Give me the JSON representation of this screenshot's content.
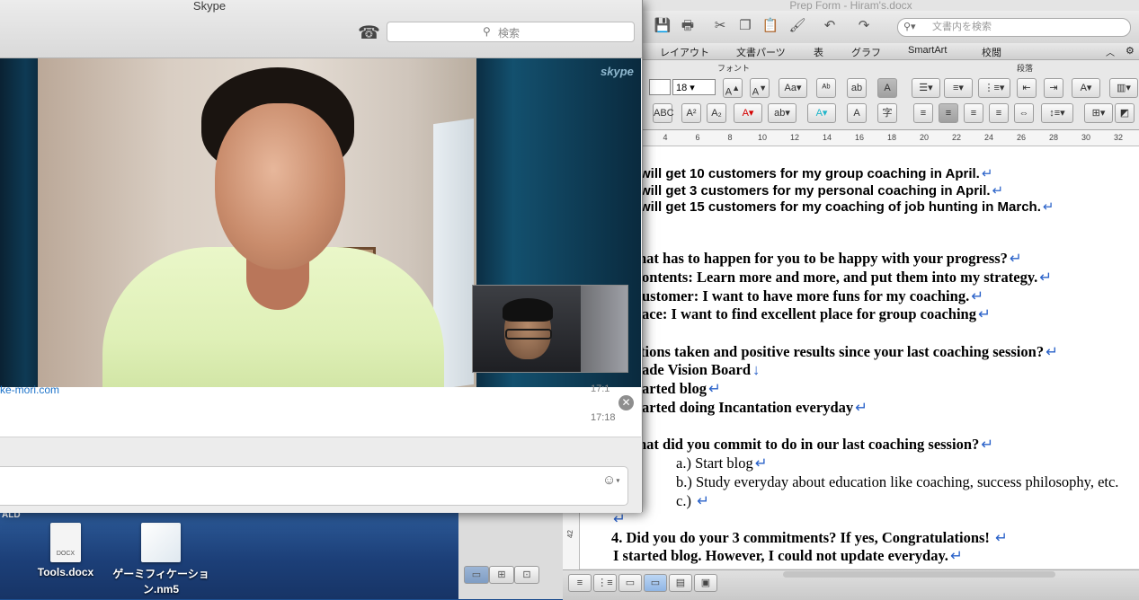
{
  "skype": {
    "title": "Skype",
    "search_placeholder": "検索",
    "watermark": "skype",
    "chat": {
      "link_text": "ke-mori.com",
      "time_top": "17:1",
      "time_bottom": "17:18"
    }
  },
  "word": {
    "title": "Prep Form - Hiram's.docx",
    "search_placeholder": "文書内を検索",
    "ribbon_tabs": [
      "レイアウト",
      "文書パーツ",
      "表",
      "グラフ",
      "SmartArt",
      "校閲"
    ],
    "group_font": "フォント",
    "group_paragraph": "段落",
    "font_size": "18",
    "ruler_ticks": [
      "4",
      "6",
      "8",
      "10",
      "12",
      "14",
      "16",
      "18",
      "20",
      "22",
      "24",
      "26",
      "28",
      "30",
      "32"
    ],
    "vruler_label": "42",
    "doc_lines": [
      "will get 10 customers for my group coaching in April.",
      "will get 3 customers for my personal coaching in April.",
      "will get 15 customers for my coaching of job hunting in March.",
      "hat has to happen for you to be happy with your progress?",
      "ontents: Learn more and more, and put them into my strategy.",
      "ustomer: I want to have more funs for my coaching.",
      "ace: I want to find excellent place for group coaching",
      "tions taken and positive results since your last coaching session?",
      "ade Vision Board",
      "arted blog",
      "arted doing Incantation everyday",
      "hat did you commit to do in our last coaching session?",
      "a.) Start blog",
      "b.) Study everyday about education like coaching, success philosophy, etc.",
      "c.)",
      "",
      "4. Did you do your 3 commitments? If yes, Congratulations!",
      "I started blog.  However, I could not update everyday."
    ]
  },
  "desktop": {
    "corner_label": "ALD",
    "icons": [
      {
        "label": "Tools.docx",
        "badge": "DOCX"
      },
      {
        "label": "ゲーミフィケーション.nm5",
        "badge": ""
      }
    ]
  },
  "colors": {
    "accent_blue": "#2a62c9",
    "link_blue": "#1b72c9"
  }
}
